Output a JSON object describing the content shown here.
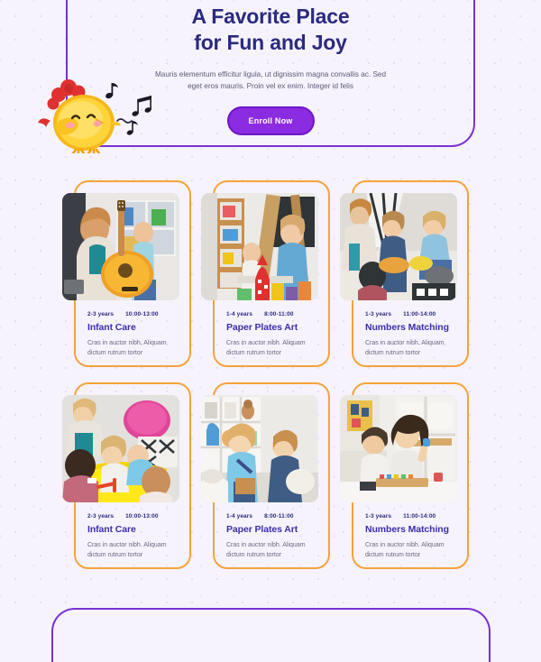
{
  "page": {
    "background_color": "#f6f3fd",
    "accent_purple": "#7b2fd4",
    "accent_orange": "#f5a33a",
    "heading_navy": "#2b2a80"
  },
  "hero": {
    "title_line1": "A Favorite Place",
    "title_line2": "for Fun and Joy",
    "subtitle": "Mauris elementum efficitur ligula, ut dignissim magna convallis ac. Sed eget eros mauris. Proin vel ex enim. Integer id felis",
    "cta_label": "Enroll Now",
    "mascot": "singing-chick-illustration",
    "mascot_notes": "music-notes-icon"
  },
  "cards": {
    "rows": [
      [
        {
          "image": "teacher-with-guitar-and-children-photo",
          "age": "2-3 years",
          "time": "10:00-13:00",
          "title": "Infant Care",
          "description": "Cras in auctor nibh. Aliquam dictum rutrum tortor"
        },
        {
          "image": "children-painting-at-easel-photo",
          "age": "1-4 years",
          "time": "8:00-11:00",
          "title": "Paper Plates Art",
          "description": "Cras in auctor nibh. Aliquam dictum rutrum tortor"
        },
        {
          "image": "teacher-reading-to-children-on-floor-photo",
          "age": "1-3 years",
          "time": "11:00-14:00",
          "title": "Numbers Matching",
          "description": "Cras in auctor nibh. Aliquam dictum rutrum tortor"
        }
      ],
      [
        {
          "image": "children-drawing-at-yellow-table-photo",
          "age": "2-3 years",
          "time": "10:00-13:00",
          "title": "Infant Care",
          "description": "Cras in auctor nibh. Aliquam dictum rutrum tortor"
        },
        {
          "image": "girl-with-book-in-playroom-photo",
          "age": "1-4 years",
          "time": "8:00-11:00",
          "title": "Paper Plates Art",
          "description": "Cras in auctor nibh. Aliquam dictum rutrum tortor"
        },
        {
          "image": "teacher-and-boy-with-blocks-photo",
          "age": "1-3 years",
          "time": "11:00-14:00",
          "title": "Numbers Matching",
          "description": "Cras in auctor nibh. Aliquam dictum rutrum tortor"
        }
      ]
    ]
  }
}
